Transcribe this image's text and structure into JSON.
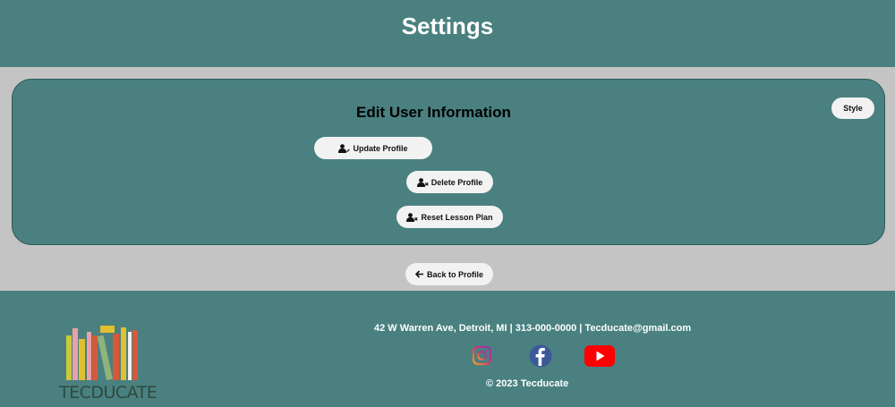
{
  "header": {
    "title": "Settings"
  },
  "card": {
    "heading": "Edit User Information",
    "style_button": "Style",
    "update_button": "Update Profile",
    "delete_button": "Delete Profile",
    "reset_button": "Reset Lesson Plan"
  },
  "nav": {
    "back_button": "Back to Profile"
  },
  "footer": {
    "contact": "42 W Warren Ave, Detroit, MI | 313-000-0000 | Tecducate@gmail.com",
    "copyright": "© 2023 Tecducate",
    "logo_text": "TECDUCATE",
    "social_icons": [
      "instagram-icon",
      "facebook-icon",
      "youtube-icon"
    ]
  },
  "colors": {
    "teal": "#4a8080",
    "gray_band": "#c4c4c4",
    "button_bg": "#f2f2f2"
  }
}
